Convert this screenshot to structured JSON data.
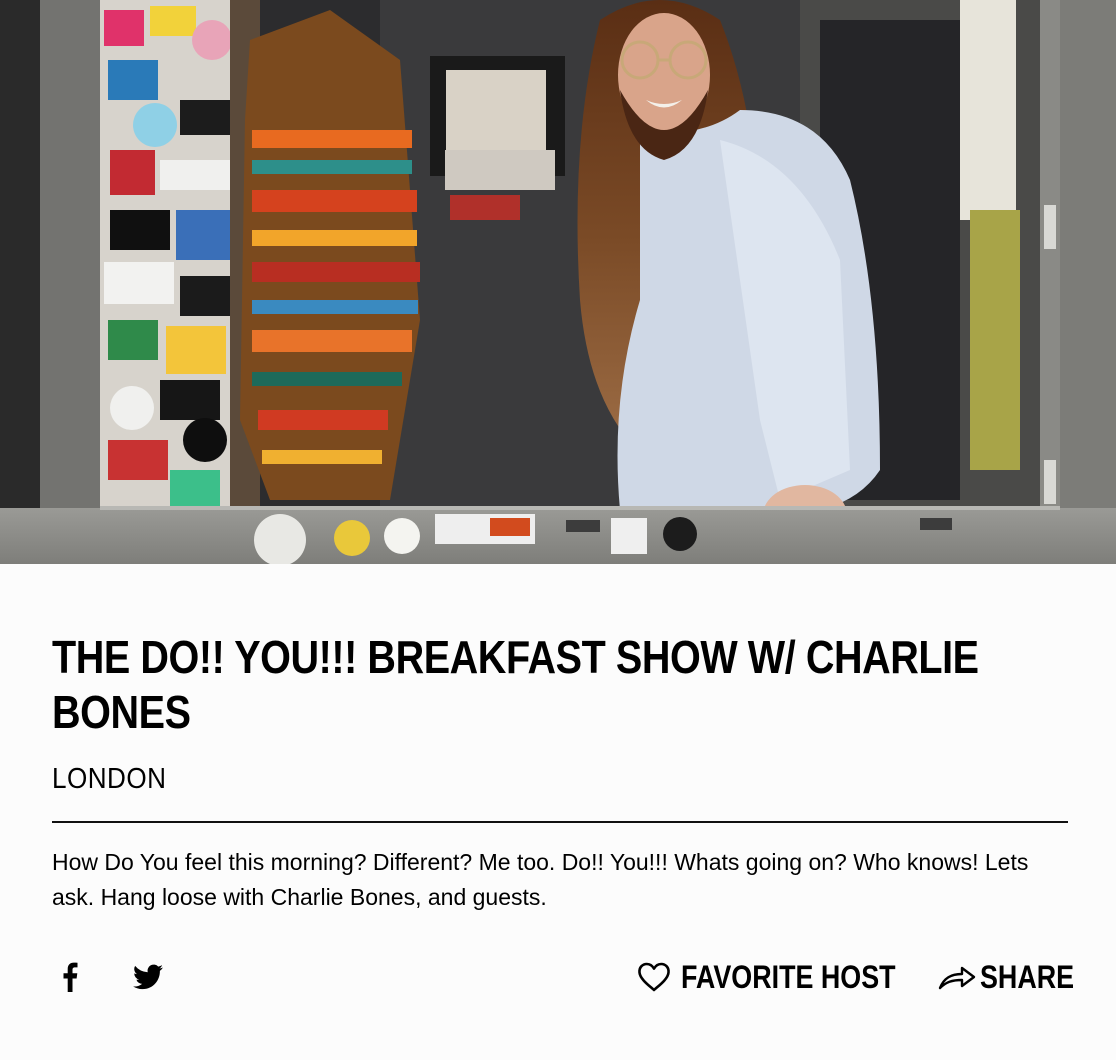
{
  "hero": {
    "image": "Host portrait: man with long hair and glasses leaning out of a sticker-covered studio booth window"
  },
  "show": {
    "title": "THE DO!! YOU!!! BREAKFAST SHOW W/ CHARLIE BONES",
    "location": "LONDON",
    "description": "How Do You feel this morning? Different? Me too. Do!! You!!! Whats going on? Who knows! Lets ask. Hang loose with Charlie Bones, and guests."
  },
  "actions": {
    "facebook_icon": "facebook-icon",
    "twitter_icon": "twitter-icon",
    "favorite_label": "FAVORITE HOST",
    "favorite_icon": "heart-outline-icon",
    "share_label": "SHARE",
    "share_icon": "share-arrow-icon"
  },
  "colors": {
    "background": "#fcfcfc",
    "text": "#000000",
    "rule": "#111111"
  }
}
